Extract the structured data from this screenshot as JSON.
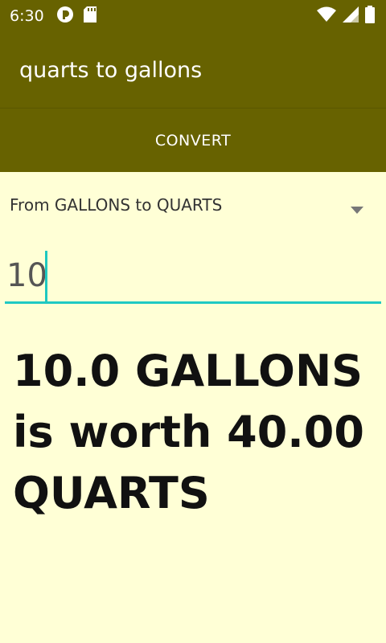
{
  "status_bar": {
    "time": "6:30",
    "left_icons": [
      "assistant-icon",
      "sd-card-icon"
    ],
    "right_icons": [
      "wifi-icon",
      "cell-signal-icon",
      "battery-icon"
    ]
  },
  "app_bar": {
    "title": "quarts to gallons"
  },
  "toolbar": {
    "convert_label": "CONVERT"
  },
  "spinner": {
    "selected": "From GALLONS to QUARTS"
  },
  "input": {
    "value": "10"
  },
  "result": {
    "text": "10.0 GALLONS is worth 40.00 QUARTS"
  },
  "colors": {
    "primary": "#676200",
    "background": "#ffffd6",
    "accent": "#20c9c3"
  }
}
